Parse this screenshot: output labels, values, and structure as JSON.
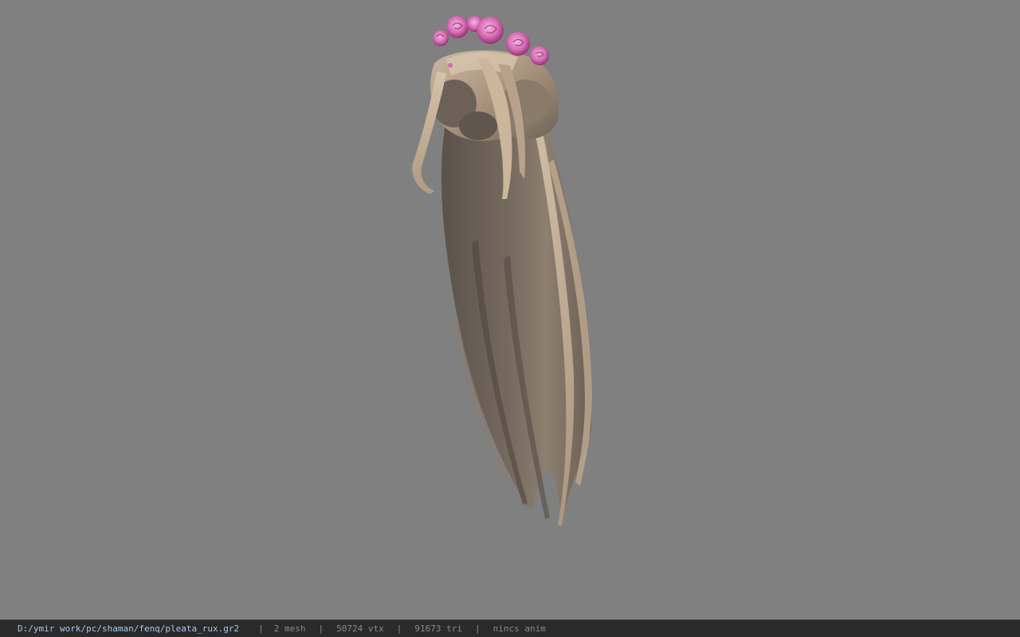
{
  "status": {
    "file_path": "D:/ymir work/pc/shaman/fenq/pleata_rux.gr2",
    "separator": "|",
    "mesh": "2 mesh",
    "vertices": "50724 vtx",
    "triangles": "91673 tri",
    "animation": "nincs anim"
  },
  "colors": {
    "background": "#808080",
    "statusbar": "#2a2a2a",
    "path_text": "#a9c8e8",
    "info_text": "#8a8a8a",
    "hair_light": "#c9b39a",
    "hair_dark": "#5e554c",
    "flower": "#d46fb0"
  },
  "model": {
    "name": "hair-with-flower-crown"
  }
}
